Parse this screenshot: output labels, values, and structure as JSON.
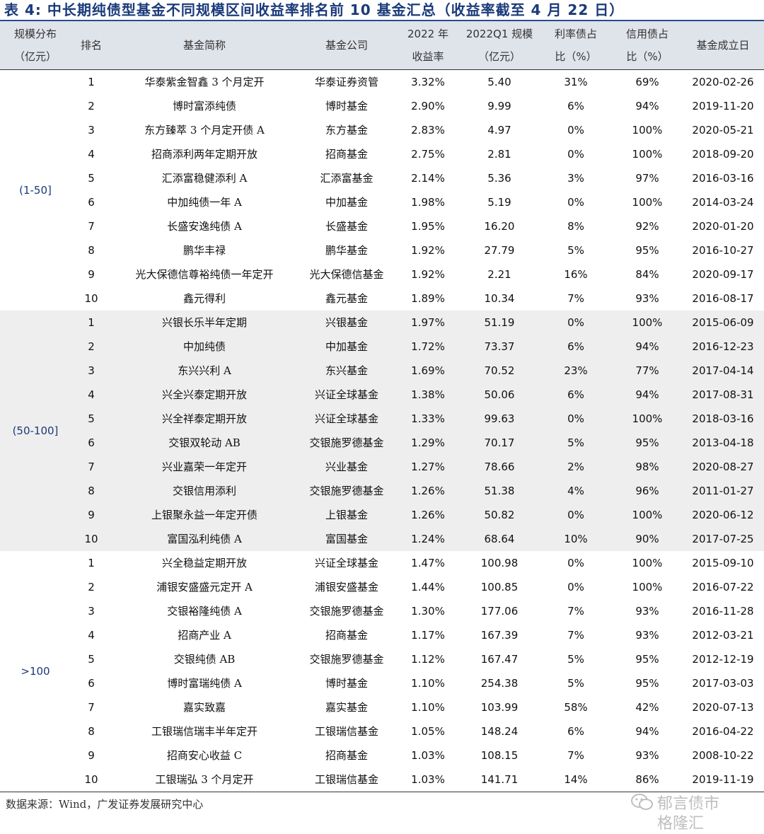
{
  "title": "表 4:  中长期纯债型基金不同规模区间收益率排名前 10 基金汇总（收益率截至 4 月 22 日）",
  "header": {
    "scale_line1": "规模分布",
    "scale_line2": "（亿元）",
    "rank": "排名",
    "name": "基金简称",
    "company": "基金公司",
    "ret_line1": "2022 年",
    "ret_line2": "收益率",
    "size_line1": "2022Q1 规模",
    "size_line2": "（亿元）",
    "rate_line1": "利率债占",
    "rate_line2": "比（%）",
    "credit_line1": "信用债占",
    "credit_line2": "比（%）",
    "date": "基金成立日"
  },
  "groups": [
    {
      "label": "(1-50]",
      "rows": [
        {
          "rank": "1",
          "name": "华泰紫金智鑫 3 个月定开",
          "company": "华泰证券资管",
          "ret": "3.32%",
          "size": "5.40",
          "rate": "31%",
          "credit": "69%",
          "date": "2020-02-26"
        },
        {
          "rank": "2",
          "name": "博时富添纯债",
          "company": "博时基金",
          "ret": "2.90%",
          "size": "9.99",
          "rate": "6%",
          "credit": "94%",
          "date": "2019-11-20"
        },
        {
          "rank": "3",
          "name": "东方臻萃 3 个月定开债 A",
          "company": "东方基金",
          "ret": "2.83%",
          "size": "4.97",
          "rate": "0%",
          "credit": "100%",
          "date": "2020-05-21"
        },
        {
          "rank": "4",
          "name": "招商添利两年定期开放",
          "company": "招商基金",
          "ret": "2.75%",
          "size": "2.81",
          "rate": "0%",
          "credit": "100%",
          "date": "2018-09-20"
        },
        {
          "rank": "5",
          "name": "汇添富稳健添利 A",
          "company": "汇添富基金",
          "ret": "2.14%",
          "size": "5.36",
          "rate": "3%",
          "credit": "97%",
          "date": "2016-03-16"
        },
        {
          "rank": "6",
          "name": "中加纯债一年 A",
          "company": "中加基金",
          "ret": "1.98%",
          "size": "5.19",
          "rate": "0%",
          "credit": "100%",
          "date": "2014-03-24"
        },
        {
          "rank": "7",
          "name": "长盛安逸纯债 A",
          "company": "长盛基金",
          "ret": "1.95%",
          "size": "16.20",
          "rate": "8%",
          "credit": "92%",
          "date": "2020-01-20"
        },
        {
          "rank": "8",
          "name": "鹏华丰禄",
          "company": "鹏华基金",
          "ret": "1.92%",
          "size": "27.79",
          "rate": "5%",
          "credit": "95%",
          "date": "2016-10-27"
        },
        {
          "rank": "9",
          "name": "光大保德信尊裕纯债一年定开",
          "company": "光大保德信基金",
          "ret": "1.92%",
          "size": "2.21",
          "rate": "16%",
          "credit": "84%",
          "date": "2020-09-17"
        },
        {
          "rank": "10",
          "name": "鑫元得利",
          "company": "鑫元基金",
          "ret": "1.89%",
          "size": "10.34",
          "rate": "7%",
          "credit": "93%",
          "date": "2016-08-17"
        }
      ]
    },
    {
      "label": "(50-100]",
      "rows": [
        {
          "rank": "1",
          "name": "兴银长乐半年定期",
          "company": "兴银基金",
          "ret": "1.97%",
          "size": "51.19",
          "rate": "0%",
          "credit": "100%",
          "date": "2015-06-09"
        },
        {
          "rank": "2",
          "name": "中加纯债",
          "company": "中加基金",
          "ret": "1.72%",
          "size": "73.37",
          "rate": "6%",
          "credit": "94%",
          "date": "2016-12-23"
        },
        {
          "rank": "3",
          "name": "东兴兴利 A",
          "company": "东兴基金",
          "ret": "1.69%",
          "size": "70.52",
          "rate": "23%",
          "credit": "77%",
          "date": "2017-04-14"
        },
        {
          "rank": "4",
          "name": "兴全兴泰定期开放",
          "company": "兴证全球基金",
          "ret": "1.38%",
          "size": "50.06",
          "rate": "6%",
          "credit": "94%",
          "date": "2017-08-31"
        },
        {
          "rank": "5",
          "name": "兴全祥泰定期开放",
          "company": "兴证全球基金",
          "ret": "1.33%",
          "size": "99.63",
          "rate": "0%",
          "credit": "100%",
          "date": "2018-03-16"
        },
        {
          "rank": "6",
          "name": "交银双轮动 AB",
          "company": "交银施罗德基金",
          "ret": "1.29%",
          "size": "70.17",
          "rate": "5%",
          "credit": "95%",
          "date": "2013-04-18"
        },
        {
          "rank": "7",
          "name": "兴业嘉荣一年定开",
          "company": "兴业基金",
          "ret": "1.27%",
          "size": "78.66",
          "rate": "2%",
          "credit": "98%",
          "date": "2020-08-27"
        },
        {
          "rank": "8",
          "name": "交银信用添利",
          "company": "交银施罗德基金",
          "ret": "1.26%",
          "size": "51.38",
          "rate": "4%",
          "credit": "96%",
          "date": "2011-01-27"
        },
        {
          "rank": "9",
          "name": "上银聚永益一年定开债",
          "company": "上银基金",
          "ret": "1.26%",
          "size": "50.82",
          "rate": "0%",
          "credit": "100%",
          "date": "2020-06-12"
        },
        {
          "rank": "10",
          "name": "富国泓利纯债 A",
          "company": "富国基金",
          "ret": "1.24%",
          "size": "68.64",
          "rate": "10%",
          "credit": "90%",
          "date": "2017-07-25"
        }
      ]
    },
    {
      "label": ">100",
      "rows": [
        {
          "rank": "1",
          "name": "兴全稳益定期开放",
          "company": "兴证全球基金",
          "ret": "1.47%",
          "size": "100.98",
          "rate": "0%",
          "credit": "100%",
          "date": "2015-09-10"
        },
        {
          "rank": "2",
          "name": "浦银安盛盛元定开 A",
          "company": "浦银安盛基金",
          "ret": "1.44%",
          "size": "100.85",
          "rate": "0%",
          "credit": "100%",
          "date": "2016-07-22"
        },
        {
          "rank": "3",
          "name": "交银裕隆纯债 A",
          "company": "交银施罗德基金",
          "ret": "1.30%",
          "size": "177.06",
          "rate": "7%",
          "credit": "93%",
          "date": "2016-11-28"
        },
        {
          "rank": "4",
          "name": "招商产业 A",
          "company": "招商基金",
          "ret": "1.17%",
          "size": "167.39",
          "rate": "7%",
          "credit": "93%",
          "date": "2012-03-21"
        },
        {
          "rank": "5",
          "name": "交银纯债 AB",
          "company": "交银施罗德基金",
          "ret": "1.12%",
          "size": "167.47",
          "rate": "5%",
          "credit": "95%",
          "date": "2012-12-19"
        },
        {
          "rank": "6",
          "name": "博时富瑞纯债 A",
          "company": "博时基金",
          "ret": "1.10%",
          "size": "254.38",
          "rate": "5%",
          "credit": "95%",
          "date": "2017-03-03"
        },
        {
          "rank": "7",
          "name": "嘉实致嘉",
          "company": "嘉实基金",
          "ret": "1.10%",
          "size": "103.99",
          "rate": "58%",
          "credit": "42%",
          "date": "2020-07-13"
        },
        {
          "rank": "8",
          "name": "工银瑞信瑞丰半年定开",
          "company": "工银瑞信基金",
          "ret": "1.05%",
          "size": "148.24",
          "rate": "6%",
          "credit": "94%",
          "date": "2016-04-22"
        },
        {
          "rank": "9",
          "name": "招商安心收益 C",
          "company": "招商基金",
          "ret": "1.03%",
          "size": "108.15",
          "rate": "7%",
          "credit": "93%",
          "date": "2008-10-22"
        },
        {
          "rank": "10",
          "name": "工银瑞弘 3 个月定开",
          "company": "工银瑞信基金",
          "ret": "1.03%",
          "size": "141.71",
          "rate": "14%",
          "credit": "86%",
          "date": "2019-11-19"
        }
      ]
    }
  ],
  "source": "数据来源：Wind，广发证券发展研究中心",
  "watermark": {
    "line1": "郁言债市",
    "line2": "格隆汇",
    "icon": "wechat-icon"
  },
  "colors": {
    "title": "#1a3a7a",
    "header_bg": "#dfe3ea",
    "group_label": "#1a3a7a",
    "alt_band": "#eeeeee"
  }
}
